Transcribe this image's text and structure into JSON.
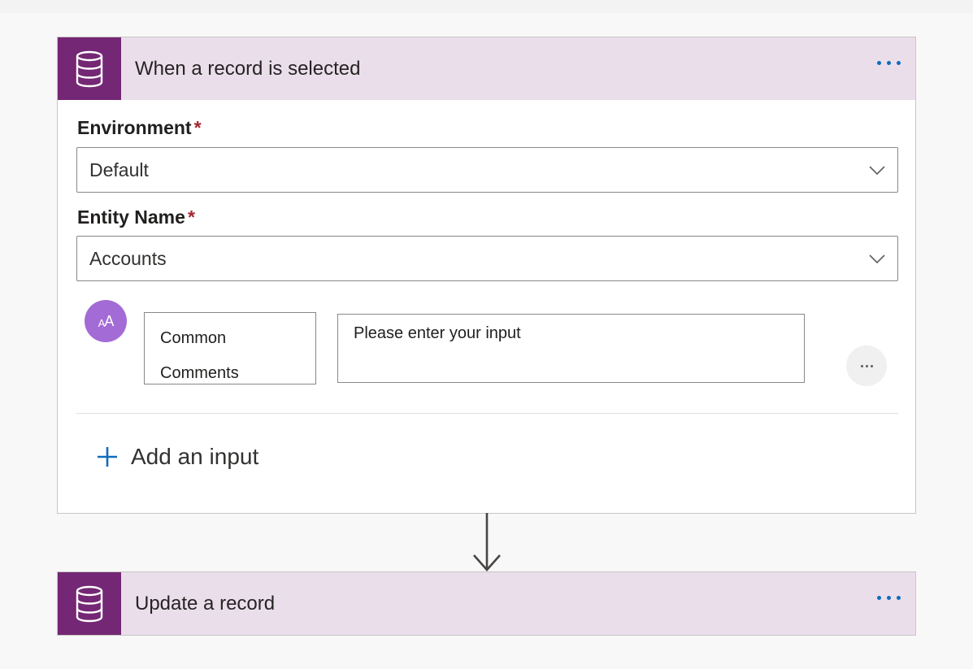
{
  "trigger": {
    "title": "When a record is selected",
    "icon": "database-icon",
    "header_color": "#ebdeeb",
    "icon_bg": "#742774",
    "fields": {
      "environment": {
        "label": "Environment",
        "required_mark": "*",
        "value": "Default"
      },
      "entity": {
        "label": "Entity Name",
        "required_mark": "*",
        "value": "Accounts"
      }
    },
    "input_row": {
      "avatar_text": "AA",
      "name_line1": "Common",
      "name_line2": "Comments",
      "value_placeholder": "Please enter your input"
    },
    "add_input_label": "Add an input"
  },
  "action": {
    "title": "Update a record",
    "icon": "database-icon"
  }
}
